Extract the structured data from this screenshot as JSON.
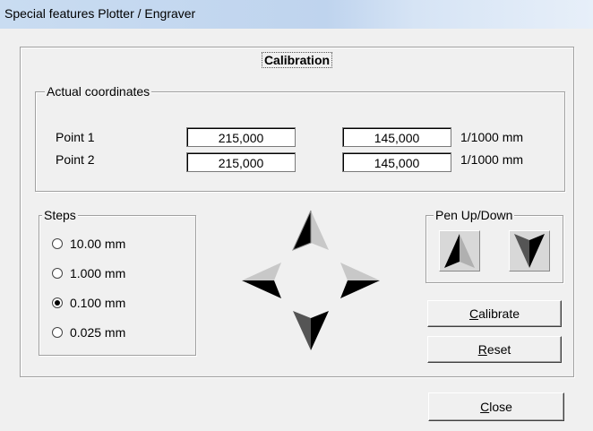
{
  "window": {
    "title": "Special features Plotter / Engraver"
  },
  "calibration": {
    "title": "Calibration"
  },
  "coordinates": {
    "legend": "Actual coordinates",
    "unit": "1/1000 mm",
    "points": [
      {
        "label": "Point 1",
        "x": "215,000",
        "y": "145,000"
      },
      {
        "label": "Point 2",
        "x": "215,000",
        "y": "145,000"
      }
    ]
  },
  "steps": {
    "legend": "Steps",
    "selected": "0.100 mm",
    "options": [
      "10.00 mm",
      "1.000 mm",
      "0.100 mm",
      "0.025 mm"
    ]
  },
  "pen": {
    "legend": "Pen Up/Down"
  },
  "buttons": {
    "calibrate": {
      "accel": "C",
      "rest": "alibrate"
    },
    "reset": {
      "accel": "R",
      "rest": "eset"
    },
    "close": {
      "accel": "C",
      "rest": "lose"
    }
  },
  "icons": [
    "arrow-up-icon",
    "arrow-left-icon",
    "arrow-right-icon",
    "arrow-down-icon",
    "pen-up-icon",
    "pen-down-icon"
  ]
}
